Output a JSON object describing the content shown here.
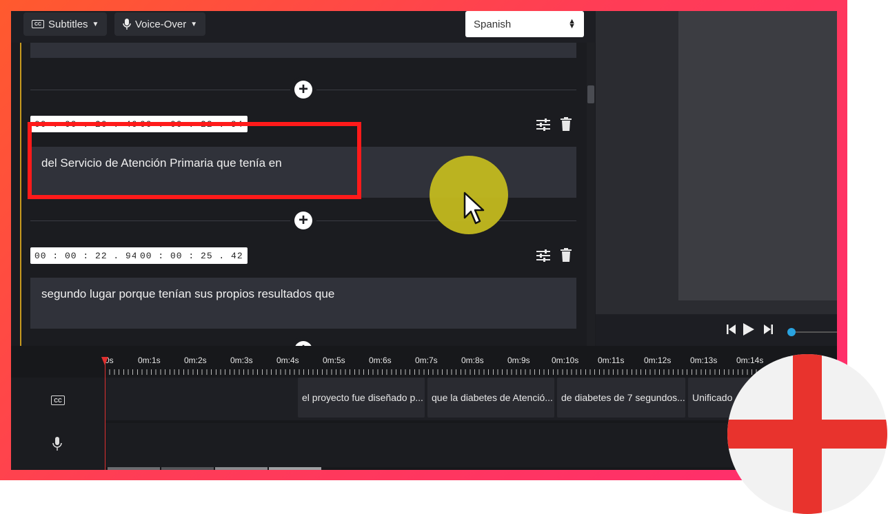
{
  "toolbar": {
    "subtitles_label": "Subtitles",
    "voiceover_label": "Voice-Over",
    "language_value": "Spanish"
  },
  "subtitles": [
    {
      "start": "00 : 00 : 20 . 46",
      "end": "00 : 00 : 22 . 94",
      "text": "del Servicio de Atención Primaria que tenía en"
    },
    {
      "start": "00 : 00 : 22 . 94",
      "end": "00 : 00 : 25 . 42",
      "text": "segundo lugar porque tenían sus propios resultados que"
    }
  ],
  "time_separator": "-",
  "timeline": {
    "ticks": [
      "0s",
      "0m:1s",
      "0m:2s",
      "0m:3s",
      "0m:4s",
      "0m:5s",
      "0m:6s",
      "0m:7s",
      "0m:8s",
      "0m:9s",
      "0m:10s",
      "0m:11s",
      "0m:12s",
      "0m:13s",
      "0m:14s"
    ],
    "clips": [
      "el proyecto fue diseñado p...",
      "que la diabetes de Atenció...",
      "de diabetes de 7 segundos...",
      "Unificado"
    ],
    "cc_label": "CC"
  },
  "colors": {
    "frame_gradient_start": "#ff5a2e",
    "frame_gradient_end": "#ff2d6e",
    "highlight_box": "#ff1a1a",
    "cursor_highlight": "#c8be1e",
    "accent_line": "#c79a1f",
    "flag_red": "#e8332d"
  },
  "icons": [
    "cc-icon",
    "mic-icon",
    "caret-down-icon",
    "select-arrows-icon",
    "add-icon",
    "tune-icon",
    "trash-icon",
    "skip-back-icon",
    "play-icon",
    "skip-forward-icon",
    "mouse-cursor-icon"
  ]
}
